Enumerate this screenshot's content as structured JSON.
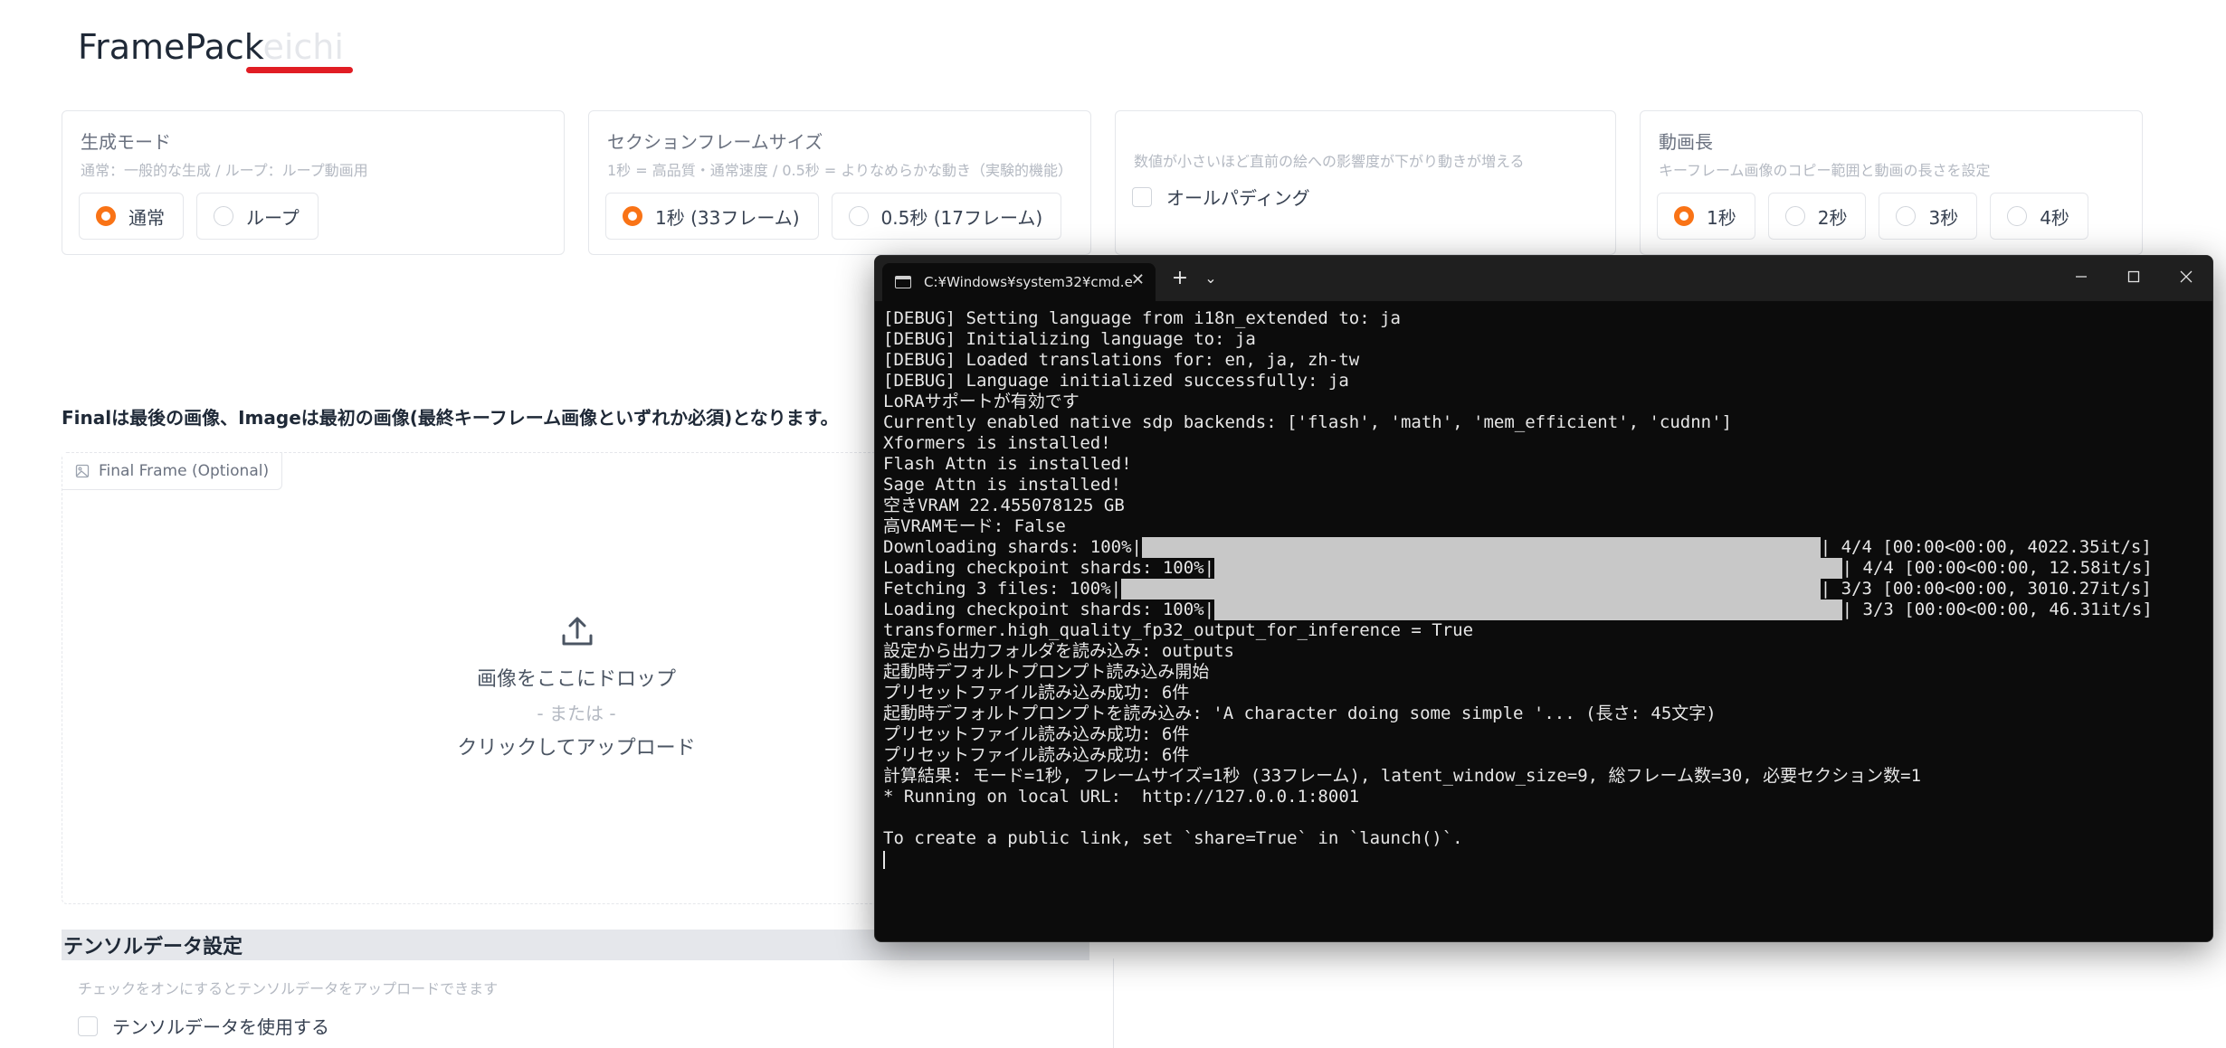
{
  "app": {
    "title": "FramePack",
    "title_suffix": "eichi"
  },
  "panels": {
    "mode": {
      "label": "生成モード",
      "desc": "通常：一般的な生成 / ループ：ループ動画用",
      "options": [
        "通常",
        "ループ"
      ],
      "selected": "通常"
    },
    "section_frame": {
      "label": "セクションフレームサイズ",
      "desc": "1秒 = 高品質・通常速度 / 0.5秒 = よりなめらかな動き（実験的機能）",
      "options": [
        "1秒 (33フレーム)",
        "0.5秒 (17フレーム)"
      ],
      "selected": "1秒 (33フレーム)"
    },
    "padding": {
      "desc": "数値が小さいほど直前の絵への影響度が下がり動きが増える",
      "checkbox_label": "オールパディング",
      "checked": false
    },
    "length": {
      "label": "動画長",
      "desc": "キーフレーム画像のコピー範囲と動画の長さを設定",
      "options": [
        "1秒",
        "2秒",
        "3秒",
        "4秒"
      ],
      "selected": "1秒"
    }
  },
  "notice": "Finalは最後の画像、Imageは最初の画像(最終キーフレーム画像といずれか必須)となります。",
  "upload": {
    "tab_label": "Final Frame (Optional)",
    "drop_text": "画像をここにドロップ",
    "or_text": "- または -",
    "click_text": "クリックしてアップロード"
  },
  "tensor": {
    "header": "テンソルデータ設定",
    "desc": "チェックをオンにするとテンソルデータをアップロードできます",
    "checkbox_label": "テンソルデータを使用する",
    "checked": false
  },
  "terminal": {
    "tab_title": "C:¥Windows¥system32¥cmd.e",
    "lines": [
      "[DEBUG] Setting language from i18n_extended to: ja",
      "[DEBUG] Initializing language to: ja",
      "[DEBUG] Loaded translations for: en, ja, zh-tw",
      "[DEBUG] Language initialized successfully: ja",
      "LoRAサポートが有効です",
      "Currently enabled native sdp backends: ['flash', 'math', 'mem_efficient', 'cudnn']",
      "Xformers is installed!",
      "Flash Attn is installed!",
      "Sage Attn is installed!",
      "空きVRAM 22.455078125 GB",
      "高VRAMモード: False"
    ],
    "progress": [
      {
        "prefix": "Downloading shards: 100%|",
        "suffix": "| 4/4 [00:00<00:00, 4022.35it/s]",
        "progress": 1.0
      },
      {
        "prefix": "Loading checkpoint shards: 100%|",
        "suffix": "| 4/4 [00:00<00:00, 12.58it/s]",
        "progress": 1.0
      },
      {
        "prefix": "Fetching 3 files: 100%|",
        "suffix": "| 3/3 [00:00<00:00, 3010.27it/s]",
        "progress": 1.0
      },
      {
        "prefix": "Loading checkpoint shards: 100%|",
        "suffix": "| 3/3 [00:00<00:00, 46.31it/s]",
        "progress": 1.0
      }
    ],
    "lines_after": [
      "transformer.high_quality_fp32_output_for_inference = True",
      "設定から出力フォルダを読み込み: outputs",
      "起動時デフォルトプロンプト読み込み開始",
      "プリセットファイル読み込み成功: 6件",
      "起動時デフォルトプロンプトを読み込み: 'A character doing some simple '... (長さ: 45文字)",
      "プリセットファイル読み込み成功: 6件",
      "プリセットファイル読み込み成功: 6件",
      "計算結果: モード=1秒, フレームサイズ=1秒 (33フレーム), latent_window_size=9, 総フレーム数=30, 必要セクション数=1",
      "* Running on local URL:  http://127.0.0.1:8001",
      "",
      "To create a public link, set `share=True` in `launch()`."
    ]
  }
}
